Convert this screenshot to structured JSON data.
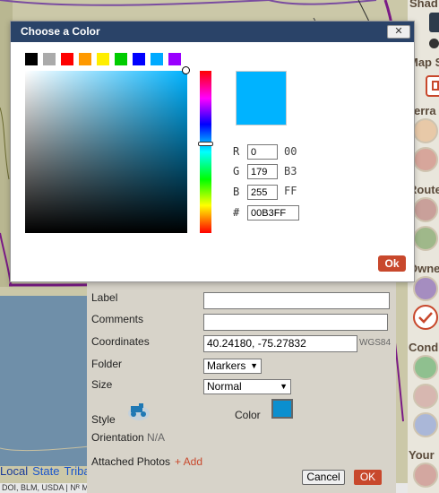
{
  "dialog": {
    "title": "Choose a Color",
    "close_label": "✕",
    "presets": [
      "#000000",
      "#aaaaaa",
      "#ff0000",
      "#ff9900",
      "#ffee00",
      "#00cc00",
      "#0000ff",
      "#00aaff",
      "#9900ff"
    ],
    "rgb": {
      "r_label": "R",
      "g_label": "G",
      "b_label": "B",
      "hash_label": "#",
      "r": "0",
      "g": "179",
      "b": "255",
      "r_hex": "00",
      "g_hex": "B3",
      "b_hex": "FF"
    },
    "hex_value": "00B3FF",
    "selected_color": "#00B3FF",
    "ok_label": "Ok"
  },
  "marker_form": {
    "label_label": "Label",
    "label_value": "",
    "comments_label": "Comments",
    "comments_value": "",
    "coordinates_label": "Coordinates",
    "coordinates_value": "40.24180, -75.27832",
    "coordinates_unit": "WGS84",
    "folder_label": "Folder",
    "folder_value": "Markers",
    "size_label": "Size",
    "size_value": "Normal",
    "style_label": "Style",
    "style_icon": "tractor-icon",
    "color_label": "Color",
    "color_value": "#0b8fcf",
    "orientation_label": "Orientation",
    "orientation_value": "N/A",
    "photos_label": "Attached Photos",
    "add_photo_label": "+ Add",
    "cancel_label": "Cancel",
    "ok_label": "OK"
  },
  "map": {
    "nav": {
      "local": "Local",
      "state": "State",
      "tribal": "Triba"
    },
    "attribution": "DOI, BLM, USDA | Nᴿ MN ᴵᶜ W | Keyboard shortcuts | Image may be subject to copyright | Terms"
  },
  "right_panel": {
    "heading_1": "Shad",
    "heading_2": "Map S",
    "heading_3": "Terra",
    "heading_4": "Route",
    "heading_5": "Owne",
    "heading_6": "Cond",
    "heading_7": "Your"
  }
}
